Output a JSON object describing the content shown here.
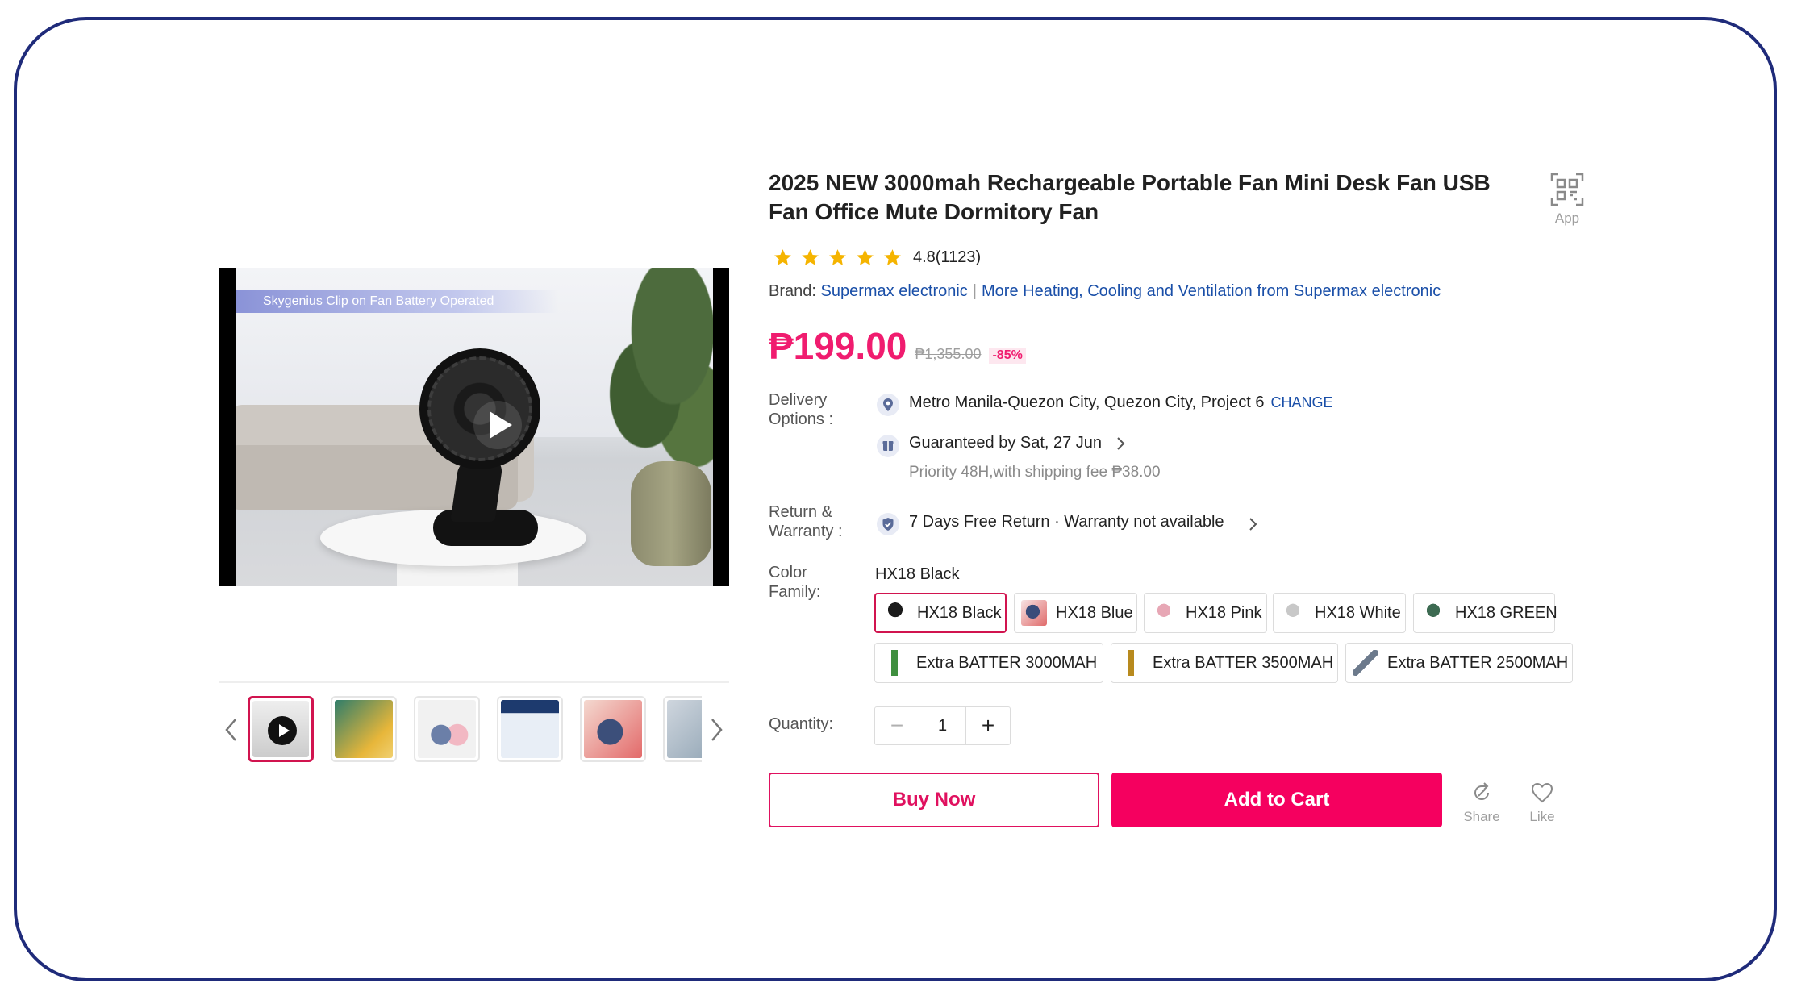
{
  "product": {
    "title": "2025 NEW 3000mah Rechargeable Portable Fan Mini Desk Fan USB Fan Office Mute Dormitory Fan",
    "app_label": "App",
    "rating_value": 4.8,
    "rating_text": "4.8(1123)",
    "stars": 5
  },
  "video": {
    "caption": "Skygenius Clip on Fan Battery Operated"
  },
  "brand": {
    "label": "Brand:",
    "name": "Supermax electronic",
    "more_link": "More Heating, Cooling and Ventilation from Supermax electronic"
  },
  "price": {
    "current": "₱199.00",
    "original": "₱1,355.00",
    "discount": "-85%"
  },
  "delivery": {
    "label": "Delivery Options :",
    "location": "Metro Manila-Quezon City, Quezon City, Project 6",
    "change": "CHANGE",
    "guarantee": "Guaranteed by Sat, 27 Jun",
    "shipping": "Priority 48H,with shipping fee ₱38.00"
  },
  "warranty": {
    "label": "Return & Warranty :",
    "text": "7 Days Free Return · Warranty not available"
  },
  "color": {
    "label": "Color Family:",
    "selected": "HX18 Black",
    "options": [
      {
        "label": "HX18 Black"
      },
      {
        "label": "HX18 Blue"
      },
      {
        "label": "HX18 Pink"
      },
      {
        "label": "HX18 White"
      },
      {
        "label": "HX18 GREEN"
      },
      {
        "label": "Extra BATTER 3000MAH"
      },
      {
        "label": "Extra BATTER 3500MAH"
      },
      {
        "label": "Extra BATTER 2500MAH"
      }
    ]
  },
  "quantity": {
    "label": "Quantity:",
    "value": "1",
    "minus": "−",
    "plus": "+"
  },
  "actions": {
    "buy_now": "Buy Now",
    "add_to_cart": "Add to Cart",
    "share": "Share",
    "like": "Like"
  },
  "colors": {
    "accent": "#f5005f",
    "link": "#1a4fa8",
    "frame": "#1f2b7a",
    "star": "#f5b400"
  }
}
